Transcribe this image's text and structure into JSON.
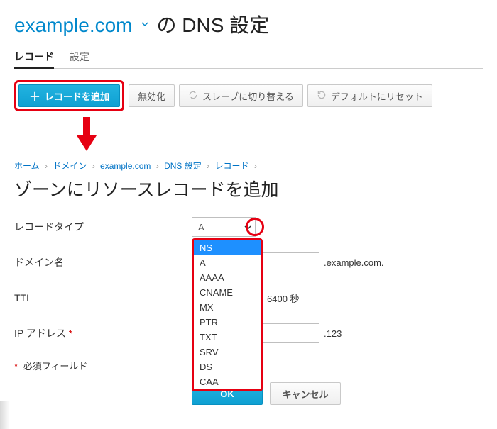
{
  "header": {
    "domain": "example.com",
    "suffix": "の DNS 設定"
  },
  "tabs": {
    "records": "レコード",
    "settings": "設定"
  },
  "toolbar": {
    "add_record": "レコードを追加",
    "disable": "無効化",
    "switch_slave": "スレーブに切り替える",
    "reset_default": "デフォルトにリセット"
  },
  "breadcrumb": {
    "home": "ホーム",
    "domain_section": "ドメイン",
    "domain": "example.com",
    "dns": "DNS 設定",
    "records": "レコード"
  },
  "page_heading": "ゾーンにリソースレコードを追加",
  "form": {
    "record_type_label": "レコードタイプ",
    "record_type_value": "A",
    "domain_name_label": "ドメイン名",
    "domain_name_value": "",
    "domain_suffix": ".example.com.",
    "ttl_label": "TTL",
    "ttl_value": "",
    "ttl_hint": "6400 秒",
    "ip_label": "IP アドレス",
    "ip_hint": ".123",
    "required_note": "必須フィールド",
    "ok": "OK",
    "cancel": "キャンセル"
  },
  "dropdown_options": [
    "NS",
    "A",
    "AAAA",
    "CNAME",
    "MX",
    "PTR",
    "TXT",
    "SRV",
    "DS",
    "CAA"
  ],
  "dropdown_selected": "NS"
}
